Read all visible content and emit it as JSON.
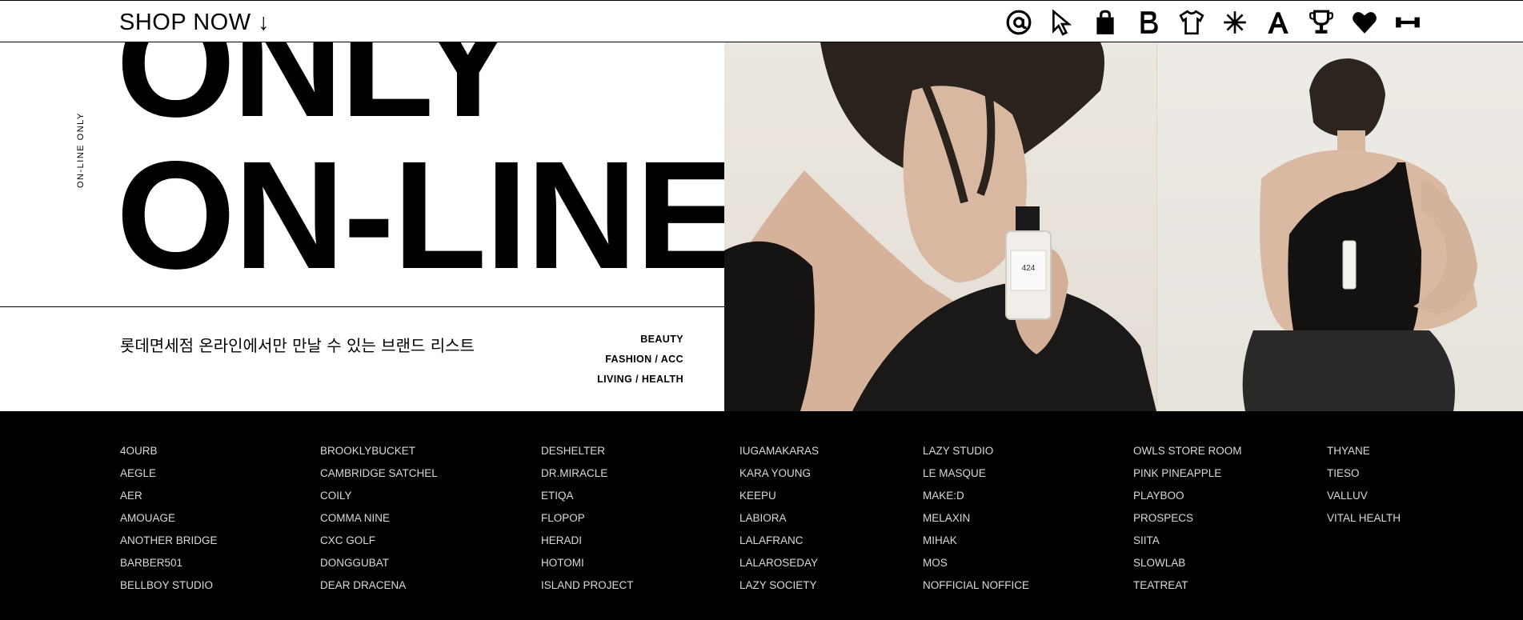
{
  "topbar": {
    "shop_now": "SHOP NOW ↓",
    "icons": [
      "at-icon",
      "cursor-icon",
      "shopping-bag-icon",
      "letter-b-icon",
      "tshirt-icon",
      "asterisk-icon",
      "letter-a-icon",
      "trophy-icon",
      "heart-icon",
      "dumbbell-icon"
    ]
  },
  "hero": {
    "vertical_text": "ON-LINE ONLY",
    "title_line1": "ONLY",
    "title_line2": "ON-LINE",
    "subtitle": "롯데면세점 온라인에서만 만날 수 있는 브랜드 리스트",
    "categories": [
      "BEAUTY",
      "FASHION / ACC",
      "LIVING / HEALTH"
    ],
    "bottle_label": "424"
  },
  "brands": {
    "columns": [
      [
        "4OURB",
        "AEGLE",
        "AER",
        "AMOUAGE",
        "ANOTHER BRIDGE",
        "BARBER501",
        "BELLBOY STUDIO"
      ],
      [
        "BROOKLYBUCKET",
        "CAMBRIDGE SATCHEL",
        "COILY",
        "COMMA NINE",
        "CXC GOLF",
        "DONGGUBAT",
        "DEAR DRACENA"
      ],
      [
        "DESHELTER",
        "DR.MIRACLE",
        "ETIQA",
        "FLOPOP",
        "HERADI",
        "HOTOMI",
        "ISLAND PROJECT"
      ],
      [
        "IUGAMAKARAS",
        "KARA YOUNG",
        "KEEPU",
        "LABIORA",
        "LALAFRANC",
        "LALAROSEDAY",
        "LAZY SOCIETY"
      ],
      [
        "LAZY STUDIO",
        "LE MASQUE",
        "MAKE:D",
        "MELAXIN",
        "MIHAK",
        "MOS",
        "NOFFICIAL NOFFICE"
      ],
      [
        "OWLS STORE ROOM",
        "PINK PINEAPPLE",
        "PLAYBOO",
        "PROSPECS",
        "SIITA",
        "SLOWLAB",
        "TEATREAT"
      ],
      [
        "THYANE",
        "TIESO",
        "VALLUV",
        "VITAL HEALTH"
      ]
    ]
  },
  "colors": {
    "background": "#ffffff",
    "brand_bg": "#000000",
    "brand_text": "#d9d9d9"
  }
}
